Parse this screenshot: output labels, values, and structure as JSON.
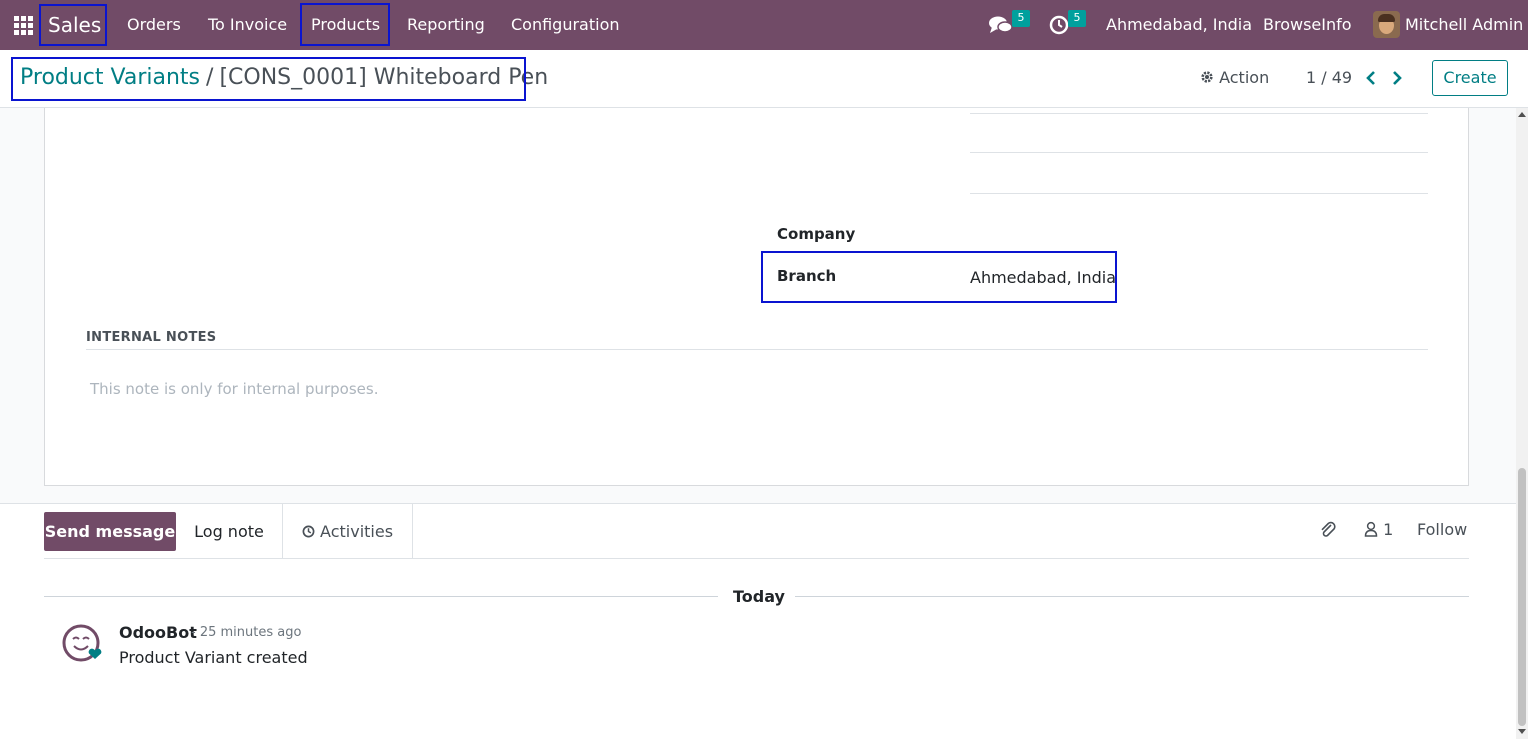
{
  "navbar": {
    "brand": "Sales",
    "menu": [
      "Orders",
      "To Invoice",
      "Products",
      "Reporting",
      "Configuration"
    ],
    "messages_count": "5",
    "activities_count": "5",
    "branch": "Ahmedabad, India",
    "company": "BrowseInfo",
    "user": "Mitchell Admin",
    "accent_color": "#714b67"
  },
  "control": {
    "breadcrumb_parent": "Product Variants",
    "breadcrumb_separator": "/",
    "breadcrumb_current": "[CONS_0001] Whiteboard Pen",
    "action_label": "Action",
    "pager": "1 / 49",
    "create_label": "Create"
  },
  "form": {
    "company_label": "Company",
    "company_value": "",
    "branch_label": "Branch",
    "branch_value": "Ahmedabad, India",
    "notes_title": "INTERNAL NOTES",
    "notes_placeholder": "This note is only for internal purposes."
  },
  "chatter": {
    "send_message": "Send message",
    "log_note": "Log note",
    "activities": "Activities",
    "followers_count": "1",
    "follow": "Follow",
    "date_separator": "Today",
    "messages": [
      {
        "author": "OdooBot",
        "time": "- 25 minutes ago",
        "body": "Product Variant created"
      }
    ]
  },
  "highlight_color": "#0a14d0"
}
